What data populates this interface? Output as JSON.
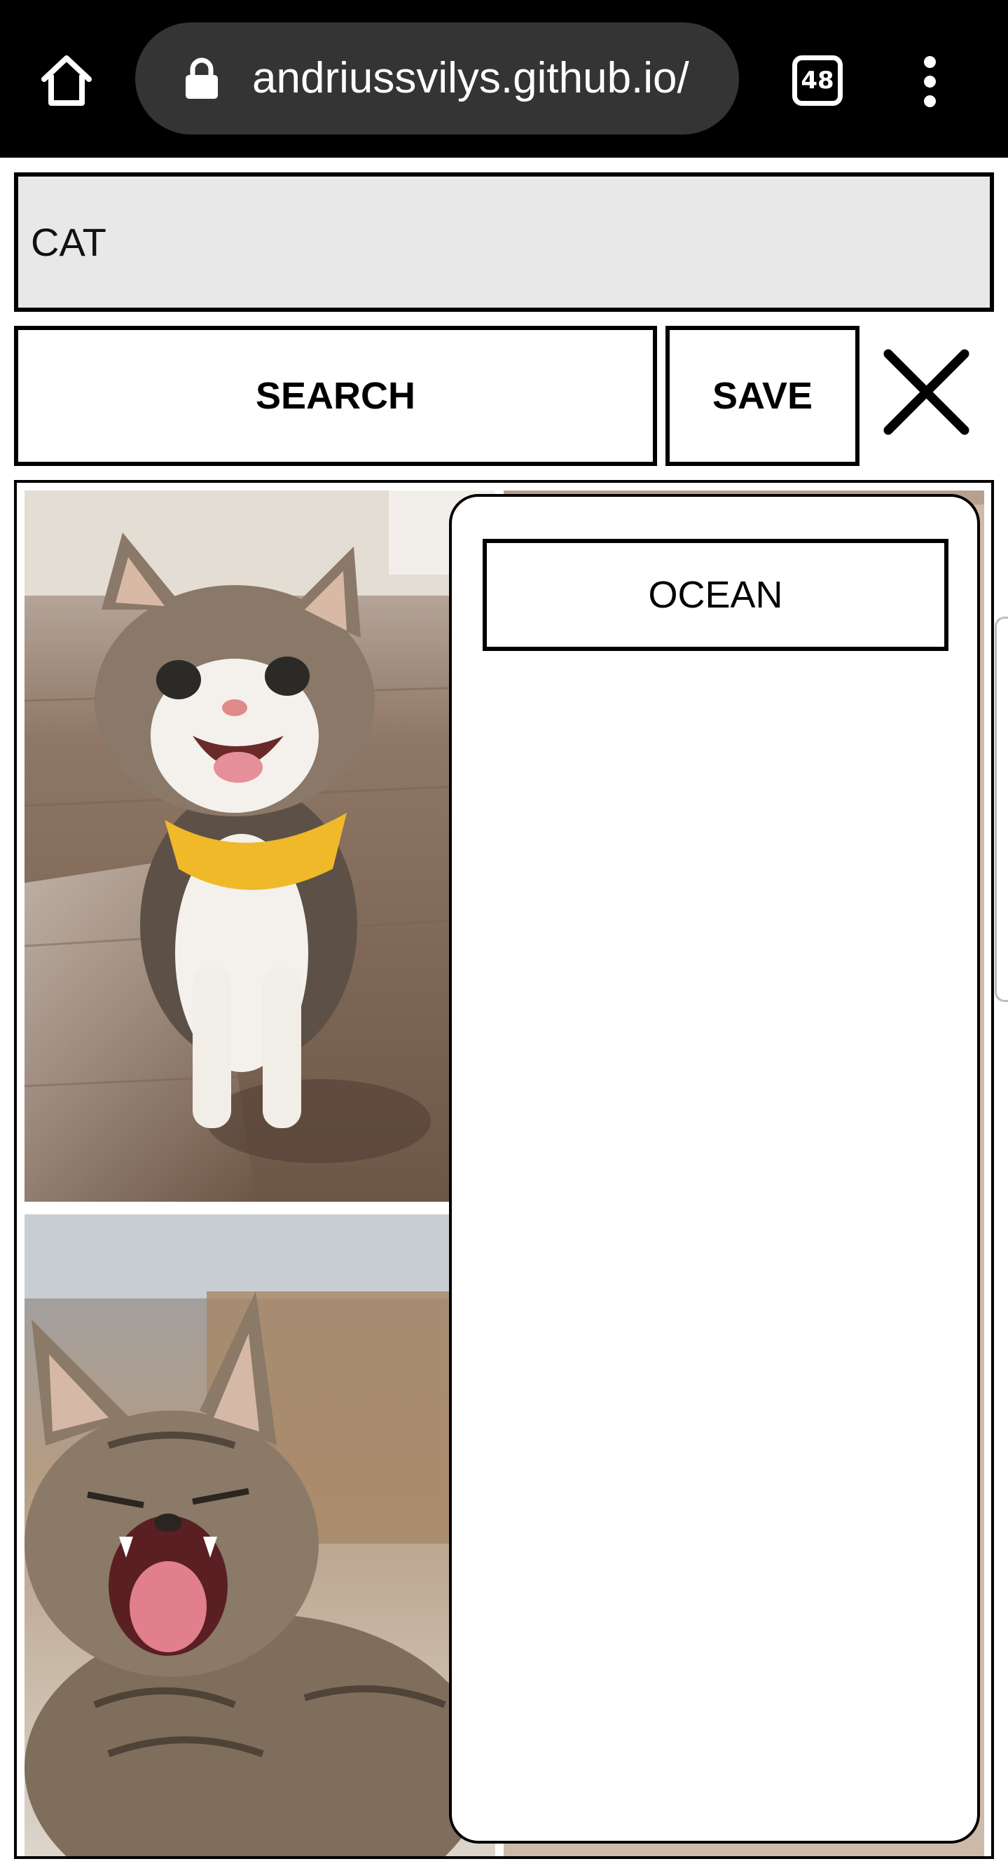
{
  "browser": {
    "url": "andriussvilys.github.io/",
    "tab_count": "48",
    "icons": [
      "home-icon",
      "lock-icon",
      "kebab-menu-icon"
    ]
  },
  "search": {
    "value": "CAT"
  },
  "buttons": {
    "search_label": "SEARCH",
    "save_label": "SAVE",
    "close_icon": "close-icon"
  },
  "results": {
    "images": [
      {
        "subject": "smiling tabby-and-white cat wearing a yellow bandana"
      },
      {
        "subject": "yawning tabby kitten"
      },
      {
        "subject": "partially hidden cat photo"
      }
    ]
  },
  "saved_searches": {
    "items": [
      {
        "label": "OCEAN"
      }
    ]
  },
  "colors": {
    "browser_bar": "#000000",
    "url_pill": "#343434",
    "input_background": "#e8e8e8",
    "border": "#000000"
  }
}
